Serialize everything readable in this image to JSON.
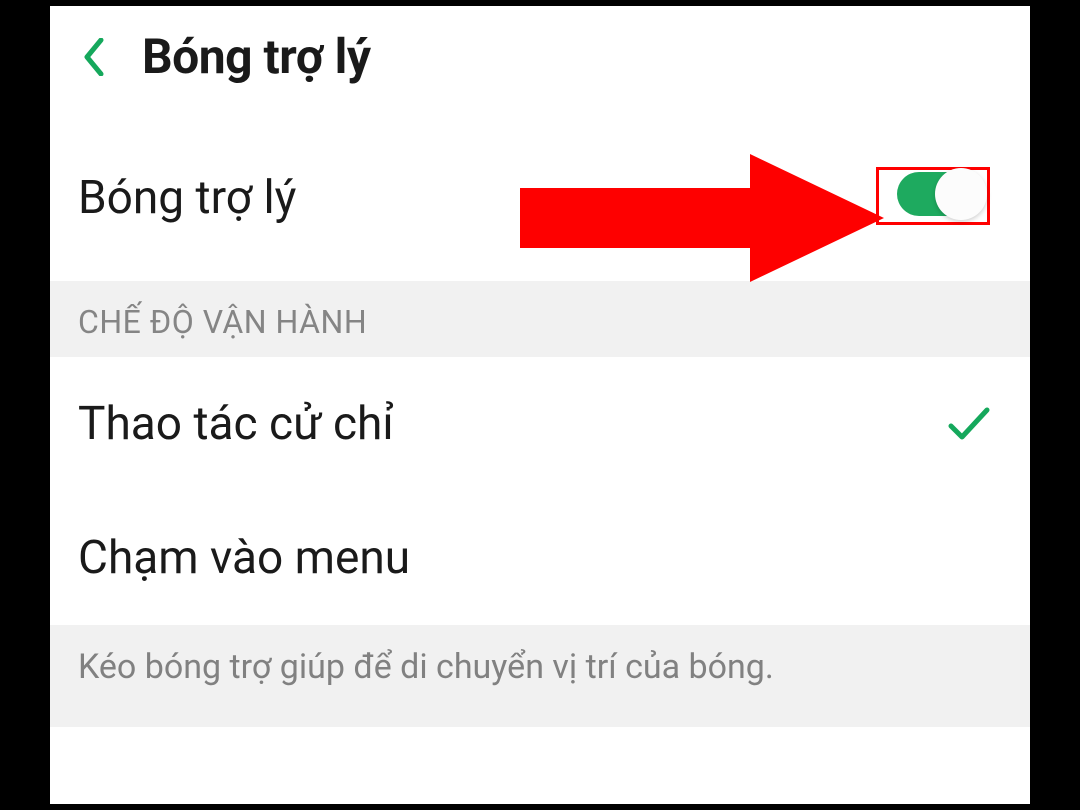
{
  "header": {
    "title": "Bóng trợ lý"
  },
  "main_toggle": {
    "label": "Bóng trợ lý",
    "on": true
  },
  "section": {
    "header": "CHẾ ĐỘ VẬN HÀNH",
    "options": [
      {
        "label": "Thao tác cử chỉ",
        "selected": true
      },
      {
        "label": "Chạm vào menu",
        "selected": false
      }
    ]
  },
  "footer": {
    "text": "Kéo bóng trợ giúp để di chuyển vị trí của bóng."
  },
  "colors": {
    "accent": "#15a85c",
    "annotation": "#ff0000"
  }
}
